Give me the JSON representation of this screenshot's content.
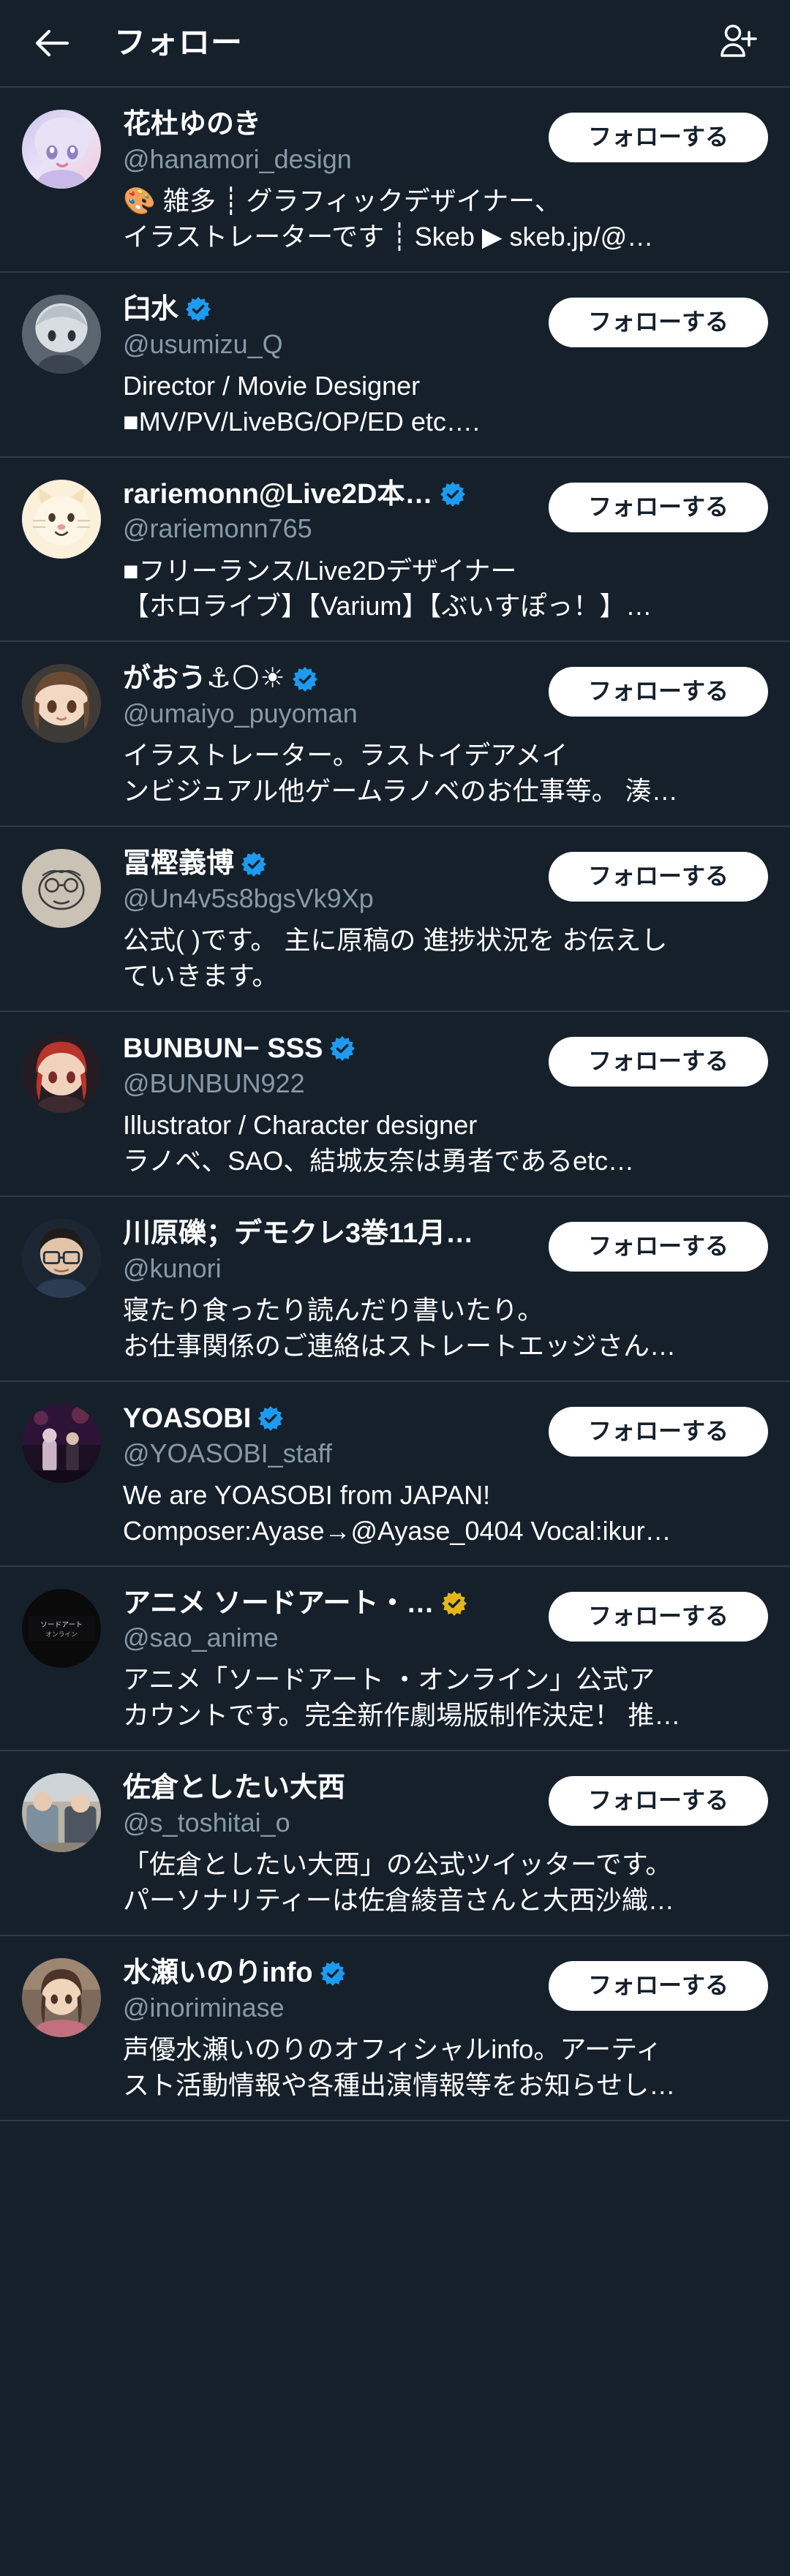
{
  "theme": {
    "bg": "#15202b",
    "divider": "#2f3b47",
    "text_primary": "#ffffff",
    "text_secondary": "#8899a6",
    "verified_blue": "#1d9bf0",
    "verified_gold": "#e2b719",
    "button_bg": "#ffffff",
    "button_text": "#15202b"
  },
  "header": {
    "title": "フォロー",
    "back_icon": "arrow-left-icon",
    "add_person_icon": "person-add-icon"
  },
  "follow_button_label": "フォローする",
  "users": [
    {
      "name": "花杜ゆのき",
      "handle": "@hanamori_design",
      "verified": "none",
      "bio_lines": [
        "🎨 雑多 ┊ グラフィックデザイナー、",
        "イラストレーターです ┊ Skeb ▶ skeb.jp/@…"
      ],
      "avatar": "anime-girl-white-purple-hair"
    },
    {
      "name": "臼水",
      "handle": "@usumizu_Q",
      "verified": "blue",
      "bio_lines": [
        "Director / Movie Designer",
        "■MV/PV/LiveBG/OP/ED etc…."
      ],
      "avatar": "anime-boy-grey-hair"
    },
    {
      "name": "rariemonn@Live2D本…",
      "handle": "@rariemonn765",
      "verified": "blue",
      "bio_lines": [
        "■フリーランス/Live2Dデザイナー",
        "【ホロライブ】【Varium】【ぶいすぽっ！】…"
      ],
      "avatar": "cream-cat-character"
    },
    {
      "name": "がおう⚓🌕☀",
      "handle": "@umaiyo_puyoman",
      "verified": "blue",
      "bio_lines": [
        "イラストレーター。ラストイデアメイ",
        "ンビジュアル他ゲームラノベのお仕事等。 湊…"
      ],
      "avatar": "anime-girl-brown-hair"
    },
    {
      "name": "冨樫義博",
      "handle": "@Un4v5s8bgsVk9Xp",
      "verified": "blue",
      "bio_lines": [
        "公式( )です。 主に原稿の 進捗状況を お伝えし",
        "ていきます。"
      ],
      "avatar": "sketch-face-beige"
    },
    {
      "name": "BUNBUN− SSS",
      "handle": "@BUNBUN922",
      "verified": "blue",
      "bio_lines": [
        "Illustrator / Character designer",
        "ラノベ、SAO、結城友奈は勇者であるetc…"
      ],
      "avatar": "red-hair-character"
    },
    {
      "name": "川原礫；デモクレ3巻11月…",
      "handle": "@kunori",
      "verified": "none",
      "bio_lines": [
        "寝たり食ったり読んだり書いたり。",
        "お仕事関係のご連絡はストレートエッジさん…"
      ],
      "avatar": "glasses-person-dark"
    },
    {
      "name": "YOASOBI",
      "handle": "@YOASOBI_staff",
      "verified": "blue",
      "bio_lines": [
        "We are YOASOBI from JAPAN!",
        "Composer:Ayase→@Ayase_0404 Vocal:ikur…"
      ],
      "avatar": "yoasobi-stage-photo"
    },
    {
      "name": "アニメ ソードアート・…",
      "handle": "@sao_anime",
      "verified": "gold",
      "bio_lines": [
        "アニメ「ソードアート ・オンライン」公式ア",
        "カウントです。完全新作劇場版制作決定！ 推…"
      ],
      "avatar": "sao-black-logo"
    },
    {
      "name": "佐倉としたい大西",
      "handle": "@s_toshitai_o",
      "verified": "none",
      "bio_lines": [
        "「佐倉としたい大西」の公式ツイッターです。",
        "パーソナリティーは佐倉綾音さんと大西沙織…"
      ],
      "avatar": "two-people-photo"
    },
    {
      "name": "水瀬いのりinfo",
      "handle": "@inoriminase",
      "verified": "blue",
      "bio_lines": [
        "声優水瀬いのりのオフィシャルinfo。アーティ",
        "スト活動情報や各種出演情報等をお知らせし…"
      ],
      "avatar": "inori-photo"
    }
  ]
}
